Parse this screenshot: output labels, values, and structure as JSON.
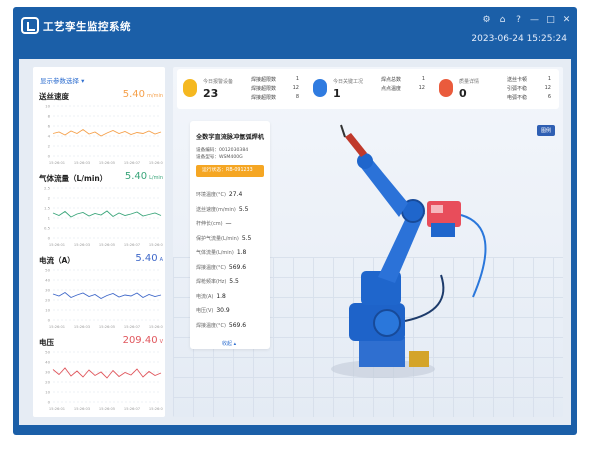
{
  "app": {
    "title": "工艺孪生监控系统",
    "datetime": "2023-06-24 15:25:24"
  },
  "window_controls": [
    "⚙",
    "⌂",
    "?",
    "—",
    "□",
    "✕"
  ],
  "left": {
    "param_select": "显示参数选择 ▾",
    "charts": [
      {
        "title": "送丝速度",
        "value": "5.40",
        "unit": "m/min",
        "color": "#f5a04a",
        "ticks": [
          "10",
          "8",
          "6",
          "4",
          "2",
          "0"
        ]
      },
      {
        "title": "气体流量（L/min）",
        "value": "5.40",
        "unit": "L/min",
        "color": "#3aa57a",
        "ticks": [
          "2.5",
          "2",
          "1.5",
          "1",
          "0.5",
          "0"
        ]
      },
      {
        "title": "电流（A）",
        "value": "5.40",
        "unit": "A",
        "color": "#3f68c9",
        "ticks": [
          "50",
          "40",
          "30",
          "20",
          "10",
          "0"
        ]
      },
      {
        "title": "电压",
        "value": "209.40",
        "unit": "V",
        "color": "#e0575d",
        "ticks": [
          "50",
          "40",
          "30",
          "20",
          "10",
          "0"
        ]
      }
    ],
    "x_ticks": [
      "15:26:01",
      "15:26:03",
      "15:26:05",
      "15:26:07",
      "15:26:09"
    ]
  },
  "stats": [
    {
      "label": "今日报警设备",
      "value": "23",
      "icon_color": "#f5b820",
      "items": [
        [
          "焊接超限数",
          "1"
        ],
        [
          "焊接超限数",
          "12"
        ],
        [
          "焊接超限数",
          "8"
        ]
      ]
    },
    {
      "label": "今日关键工况",
      "value": "1",
      "icon_color": "#2f7be0",
      "items": [
        [
          "焊点总数",
          "1"
        ],
        [
          "点点温度",
          "12"
        ]
      ]
    },
    {
      "label": "质量详情",
      "value": "0",
      "icon_color": "#ea5b3c",
      "items": [
        [
          "送丝卡顿",
          "1"
        ],
        [
          "引弧不稳",
          "12"
        ],
        [
          "电弧不稳",
          "6"
        ]
      ]
    }
  ],
  "legend_btn": "图例",
  "device": {
    "name": "全数字直流脉冲氩弧焊机",
    "code": "设备编码：0012030384",
    "model": "设备型号：WSM400G",
    "status": "运行状态：RB-091233",
    "rows": [
      {
        "label": "环境温度(°C)",
        "value": "27.4"
      },
      {
        "label": "送丝速度(m/min)",
        "value": "5.5"
      },
      {
        "label": "杆伸长(cm)",
        "value": "—"
      },
      {
        "label": "保护气流量(L/min)",
        "value": "5.5"
      },
      {
        "label": "气体流量(L/min)",
        "value": "1.8"
      },
      {
        "label": "焊接温度(°C)",
        "value": "569.6"
      },
      {
        "label": "焊枪频率(Hz)",
        "value": "5.5"
      },
      {
        "label": "电流(A)",
        "value": "1.8"
      },
      {
        "label": "电压(V)",
        "value": "30.9"
      },
      {
        "label": "焊接温度(°C)",
        "value": "569.6"
      }
    ],
    "collapse": "收起 ▴"
  }
}
